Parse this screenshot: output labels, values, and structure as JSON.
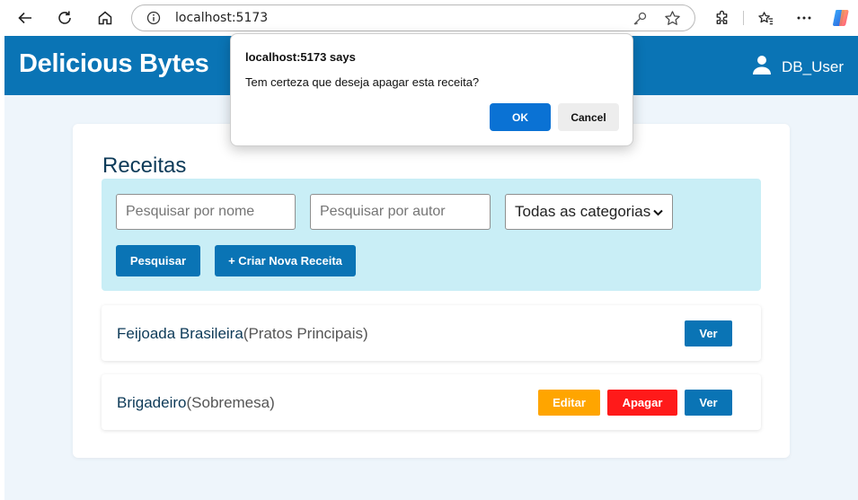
{
  "browser": {
    "url": "localhost:5173"
  },
  "header": {
    "brand": "Delicious Bytes",
    "user_name": "DB_User"
  },
  "recipes_section": {
    "title": "Receitas",
    "search_name_placeholder": "Pesquisar por nome",
    "search_author_placeholder": "Pesquisar por autor",
    "category_select_value": "Todas as categorias",
    "search_button": "Pesquisar",
    "create_button": "+ Criar Nova Receita"
  },
  "recipes": [
    {
      "name": "Feijoada Brasileira",
      "category": "(Pratos Principais)",
      "view_label": "Ver"
    },
    {
      "name": "Brigadeiro",
      "category": "(Sobremesa)",
      "edit_label": "Editar",
      "delete_label": "Apagar",
      "view_label": "Ver"
    }
  ],
  "dialog": {
    "title": "localhost:5173 says",
    "message": "Tem certeza que deseja apagar esta receita?",
    "ok_label": "OK",
    "cancel_label": "Cancel"
  },
  "colors": {
    "primary": "#0a74b5",
    "edit": "#ffa500",
    "delete": "#ff1a1a",
    "filter_panel": "#c9eef6"
  }
}
